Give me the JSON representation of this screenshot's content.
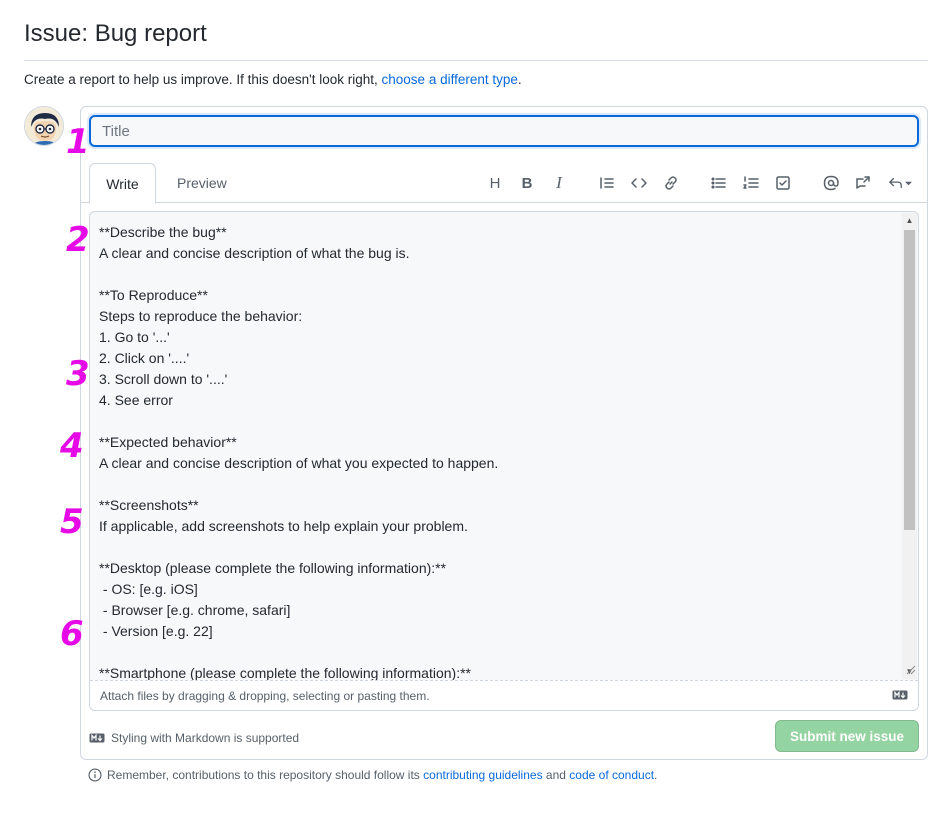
{
  "page": {
    "title": "Issue: Bug report",
    "subtitle_text": "Create a report to help us improve. If this doesn't look right,",
    "subtitle_link": "choose a different type",
    "subtitle_end": "."
  },
  "form": {
    "title_placeholder": "Title",
    "tabs": [
      {
        "label": "Write"
      },
      {
        "label": "Preview"
      }
    ],
    "toolbar": {
      "heading": "H",
      "bold": "B",
      "italic": "I"
    },
    "body_text": "**Describe the bug**\nA clear and concise description of what the bug is.\n\n**To Reproduce**\nSteps to reproduce the behavior:\n1. Go to '...'\n2. Click on '....'\n3. Scroll down to '....'\n4. See error\n\n**Expected behavior**\nA clear and concise description of what you expected to happen.\n\n**Screenshots**\nIf applicable, add screenshots to help explain your problem.\n\n**Desktop (please complete the following information):**\n - OS: [e.g. iOS]\n - Browser [e.g. chrome, safari]\n - Version [e.g. 22]\n\n**Smartphone (please complete the following information):**",
    "attach_text": "Attach files by dragging & dropping, selecting or pasting them.",
    "markdown_note": "Styling with Markdown is supported",
    "submit_label": "Submit new issue"
  },
  "footer": {
    "remember_text": "Remember, contributions to this repository should follow its",
    "guidelines_link": "contributing guidelines",
    "and_text": "and",
    "conduct_link": "code of conduct",
    "end": "."
  },
  "annotations": [
    "1",
    "2",
    "3",
    "4",
    "5",
    "6"
  ],
  "colors": {
    "accent": "#0969da",
    "annotation": "#e60ae6",
    "submit_disabled": "#94d3a2"
  }
}
